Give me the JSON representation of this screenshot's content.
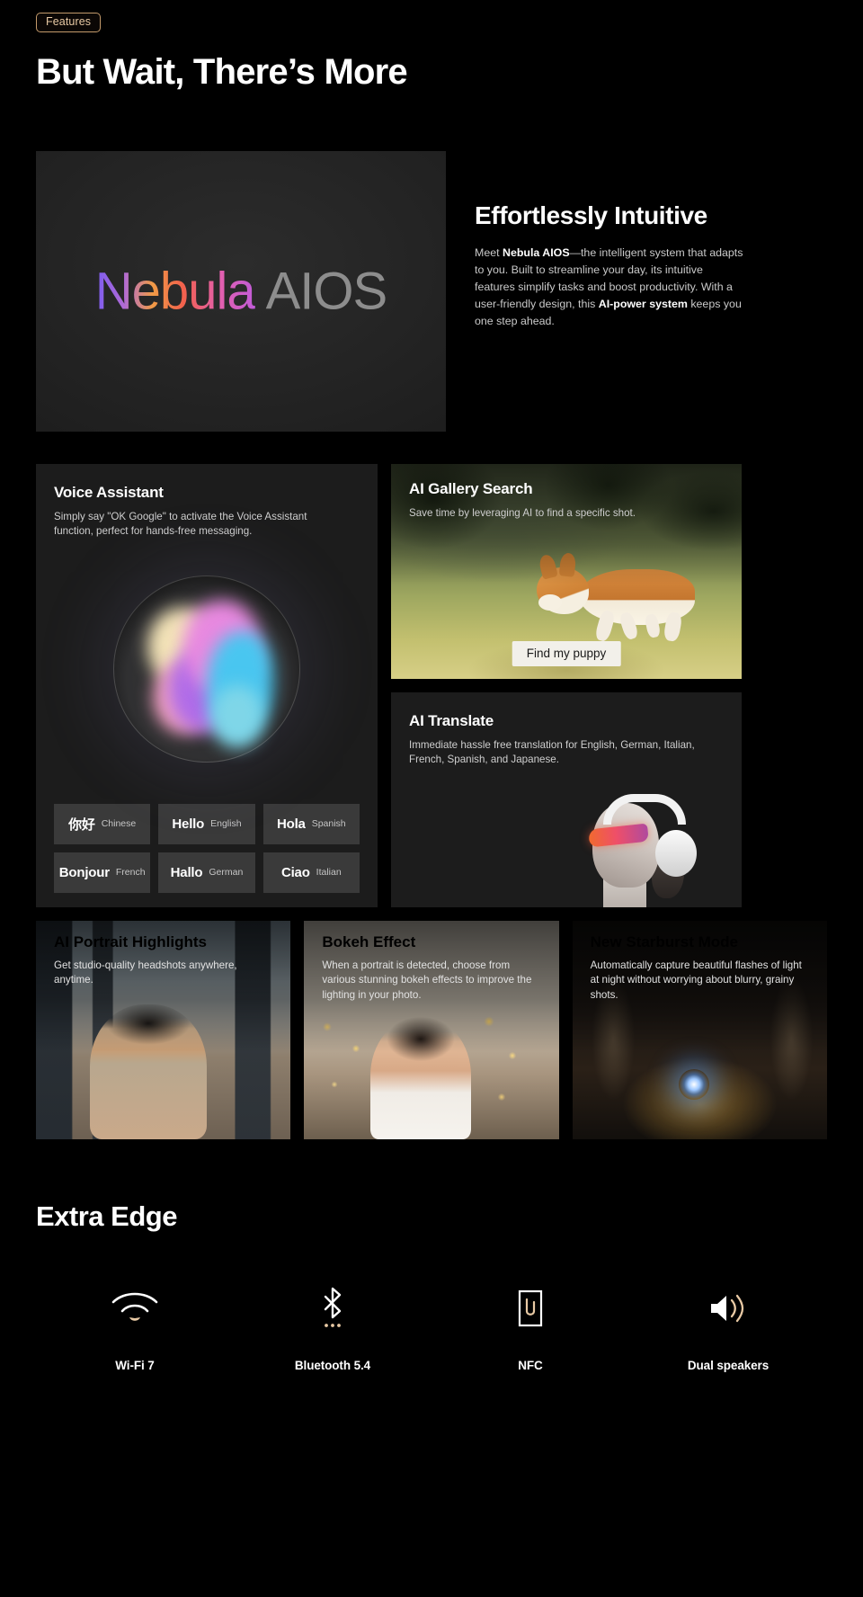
{
  "header": {
    "badge": "Features",
    "title": "But Wait, There’s More"
  },
  "hero": {
    "wordmark_gradient": "Nebula",
    "wordmark_plain": "AIOS",
    "heading": "Effortlessly Intuitive",
    "body_1": "Meet ",
    "body_bold_1": "Nebula AIOS",
    "body_2": "—the intelligent system that adapts to you. Built to streamline your day, its intuitive features simplify tasks and boost productivity. With a user-friendly design, this ",
    "body_bold_2": "AI-power system",
    "body_3": " keeps you one step ahead."
  },
  "voice_assistant": {
    "title": "Voice Assistant",
    "subtitle": "Simply say \"OK Google\" to activate the Voice Assistant function, perfect for hands-free messaging.",
    "languages": [
      {
        "word": "你好",
        "name": "Chinese"
      },
      {
        "word": "Hello",
        "name": "English"
      },
      {
        "word": "Hola",
        "name": "Spanish"
      },
      {
        "word": "Bonjour",
        "name": "French"
      },
      {
        "word": "Hallo",
        "name": "German"
      },
      {
        "word": "Ciao",
        "name": "Italian"
      }
    ]
  },
  "gallery_search": {
    "title": "AI Gallery Search",
    "subtitle": "Save time by leveraging AI to find a specific shot.",
    "button": "Find my puppy"
  },
  "translate": {
    "title": "AI Translate",
    "subtitle": "Immediate hassle free translation for English, German, Italian, French, Spanish, and Japanese."
  },
  "photo_cards": [
    {
      "title": "AI Portrait Highlights",
      "subtitle": "Get studio-quality headshots anywhere, anytime."
    },
    {
      "title": "Bokeh Effect",
      "subtitle": "When a portrait is detected, choose from various stunning bokeh effects to improve the lighting in your photo."
    },
    {
      "title": "New Starburst Mode",
      "subtitle": "Automatically capture beautiful flashes of light at night without worrying about blurry, grainy shots."
    }
  ],
  "extra_edge": {
    "title": "Extra Edge",
    "specs": [
      {
        "icon": "wifi-icon",
        "label": "Wi-Fi 7"
      },
      {
        "icon": "bluetooth-icon",
        "label": "Bluetooth 5.4"
      },
      {
        "icon": "nfc-icon",
        "label": "NFC"
      },
      {
        "icon": "speaker-icon",
        "label": "Dual speakers"
      }
    ]
  },
  "colors": {
    "background": "#000000",
    "card": "#1c1c1c",
    "chip": "#3a3a3a",
    "accent_tan": "#e8c9a4",
    "accent_border": "#c39a6b"
  }
}
